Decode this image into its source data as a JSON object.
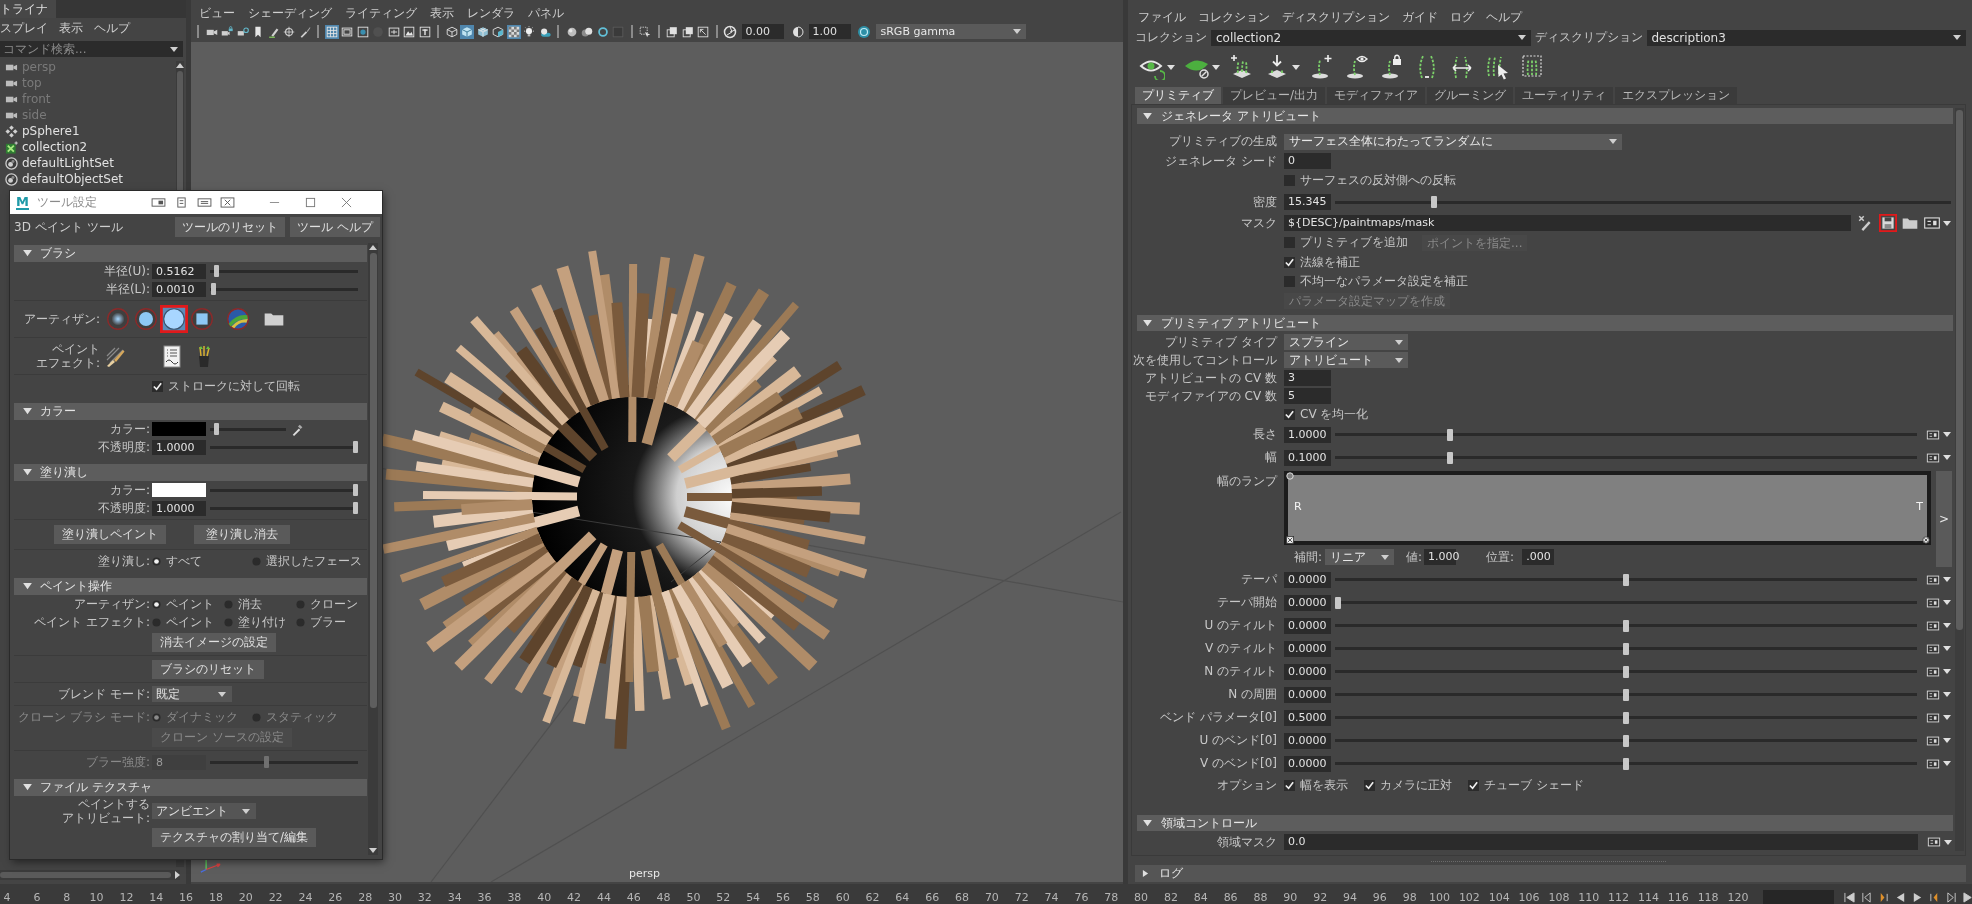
{
  "outliner": {
    "tab": "トライナ",
    "menu": [
      "スプレイ",
      "表示",
      "ヘルプ"
    ],
    "search": {
      "placeholder": "コマンド検索..."
    },
    "items": [
      {
        "label": "persp",
        "kind": "camera",
        "dimmed": true
      },
      {
        "label": "top",
        "kind": "camera",
        "dimmed": true
      },
      {
        "label": "front",
        "kind": "camera",
        "dimmed": true
      },
      {
        "label": "side",
        "kind": "camera",
        "dimmed": true
      },
      {
        "label": "pSphere1",
        "kind": "mesh",
        "dimmed": false
      },
      {
        "label": "collection2",
        "kind": "collection",
        "dimmed": false
      },
      {
        "label": "defaultLightSet",
        "kind": "set",
        "dimmed": false
      },
      {
        "label": "defaultObjectSet",
        "kind": "set",
        "dimmed": false
      }
    ]
  },
  "viewport": {
    "menu": [
      "ビュー",
      "シェーディング",
      "ライティング",
      "表示",
      "レンダラ",
      "パネル"
    ],
    "toolbar": [
      {
        "kind": "sep"
      },
      {
        "kind": "camera",
        "on": false
      },
      {
        "kind": "camlock",
        "on": false
      },
      {
        "kind": "camattr",
        "on": false
      },
      {
        "kind": "bookmark",
        "on": false
      },
      {
        "kind": "pen",
        "on": false
      },
      {
        "kind": "target",
        "on": false
      },
      {
        "kind": "brush",
        "on": false
      },
      {
        "kind": "sep"
      },
      {
        "kind": "grid",
        "on": true
      },
      {
        "kind": "film",
        "on": false
      },
      {
        "kind": "gate",
        "on": false
      },
      {
        "kind": "dot",
        "on": false
      },
      {
        "kind": "frame",
        "on": false
      },
      {
        "kind": "image",
        "on": false
      },
      {
        "kind": "text",
        "on": false
      },
      {
        "kind": "sep"
      },
      {
        "kind": "wire",
        "on": false
      },
      {
        "kind": "shaded",
        "on": true
      },
      {
        "kind": "textured",
        "on": false
      },
      {
        "kind": "lit",
        "on": false
      },
      {
        "kind": "xray",
        "on": true
      },
      {
        "kind": "bulb",
        "on": false
      },
      {
        "kind": "shadow",
        "on": false
      },
      {
        "kind": "sep"
      },
      {
        "kind": "ball",
        "on": false
      },
      {
        "kind": "balls",
        "on": false
      },
      {
        "kind": "ring",
        "on": false
      },
      {
        "kind": "square",
        "on": false
      },
      {
        "kind": "sep"
      },
      {
        "kind": "select",
        "on": false
      },
      {
        "kind": "sep"
      },
      {
        "kind": "copy",
        "on": false
      },
      {
        "kind": "copy",
        "on": false
      },
      {
        "kind": "resize",
        "on": false
      },
      {
        "kind": "sep"
      }
    ],
    "exposure": "0.00",
    "gamma": "1.00",
    "color_space": "sRGB gamma",
    "camera": "persp"
  },
  "tool_settings": {
    "logo": "M",
    "title": "ツール設定",
    "tool": "3D ペイント ツール",
    "buttons": [
      {
        "label": "ツールのリセット"
      },
      {
        "label": "ツール ヘルプ"
      }
    ],
    "sections": [
      {
        "title": "ブラシ",
        "expanded": true,
        "groups": [
          [
            {
              "kind": "slider",
              "label": "半径(U):",
              "value": "0.5162",
              "level": 0.03,
              "disabled": false
            },
            {
              "kind": "slider",
              "label": "半径(L):",
              "value": "0.0010",
              "level": 0.01,
              "disabled": false
            }
          ],
          [
            {
              "kind": "brushes",
              "label": "アーティザン:",
              "items": [
                {
                  "kind": "soft",
                  "selected": false,
                  "highlighted": false
                },
                {
                  "kind": "round",
                  "selected": false,
                  "highlighted": false
                },
                {
                  "kind": "large",
                  "selected": true,
                  "highlighted": true
                },
                {
                  "kind": "square",
                  "selected": false,
                  "highlighted": false
                },
                {
                  "kind": "globe",
                  "selected": false,
                  "highlighted": false
                },
                {
                  "kind": "folder",
                  "selected": false,
                  "highlighted": false
                }
              ]
            }
          ],
          [
            {
              "kind": "effects",
              "label_lines": [
                "ペイント",
                "エフェクト:"
              ],
              "items": [
                {
                  "kind": "stroke"
                },
                {
                  "kind": "document"
                },
                {
                  "kind": "bucket"
                }
              ]
            }
          ],
          [
            {
              "kind": "checkbox",
              "label": "ストロークに対して回転",
              "checked": true
            }
          ]
        ]
      },
      {
        "title": "カラー",
        "expanded": true,
        "groups": [
          [
            {
              "kind": "color",
              "label": "カラー:",
              "color": "#000000",
              "level": 0.05,
              "picker": true
            },
            {
              "kind": "slider",
              "label": "不透明度:",
              "value": "1.0000",
              "level": 1,
              "disabled": false
            }
          ]
        ]
      },
      {
        "title": "塗り潰し",
        "expanded": true,
        "groups": [
          [
            {
              "kind": "color",
              "label": "カラー:",
              "color": "#ffffff",
              "level": 1,
              "picker": false
            },
            {
              "kind": "slider",
              "label": "不透明度:",
              "value": "1.0000",
              "level": 1,
              "disabled": false
            }
          ],
          [
            {
              "kind": "buttons",
              "items": [
                {
                  "label": "塗り潰しペイント"
                },
                {
                  "label": "塗り潰し消去"
                }
              ]
            }
          ],
          [
            {
              "kind": "radios",
              "label": "塗り潰し:",
              "disabled": false,
              "options": [
                {
                  "label": "すべて",
                  "selected": true
                },
                {
                  "label": "選択したフェース",
                  "selected": false
                }
              ]
            }
          ]
        ]
      },
      {
        "title": "ペイント操作",
        "expanded": true,
        "groups": [
          [
            {
              "kind": "radios",
              "label": "アーティザン:",
              "disabled": false,
              "options": [
                {
                  "label": "ペイント",
                  "selected": true
                },
                {
                  "label": "消去",
                  "selected": false
                },
                {
                  "label": "クローン",
                  "selected": false
                }
              ]
            },
            {
              "kind": "radios",
              "label": "ペイント エフェクト:",
              "disabled": false,
              "options": [
                {
                  "label": "ペイント",
                  "selected": false
                },
                {
                  "label": "塗り付け",
                  "selected": false
                },
                {
                  "label": "ブラー",
                  "selected": false
                }
              ]
            },
            {
              "kind": "button",
              "label": "消去イメージの設定",
              "disabled": false
            }
          ],
          [
            {
              "kind": "button",
              "label": "ブラシのリセット",
              "disabled": false
            }
          ],
          [
            {
              "kind": "dropdown",
              "label": "ブレンド モード:",
              "value": "既定"
            }
          ],
          [
            {
              "kind": "radios",
              "label": "クローン ブラシ モード:",
              "disabled": true,
              "options": [
                {
                  "label": "ダイナミック",
                  "selected": true
                },
                {
                  "label": "スタティック",
                  "selected": false
                }
              ]
            },
            {
              "kind": "button",
              "label": "クローン ソースの設定",
              "disabled": true
            }
          ],
          [
            {
              "kind": "slider",
              "label": "ブラー強度:",
              "value": "8",
              "level": 0.38,
              "disabled": true
            }
          ]
        ]
      },
      {
        "title": "ファイル テクスチャ",
        "expanded": true,
        "groups": [
          [
            {
              "kind": "dropdown",
              "label_lines": [
                "ペイントする",
                "アトリビュート:"
              ],
              "value": "アンビエント"
            },
            {
              "kind": "button",
              "label": "テクスチャの割り当て/編集",
              "disabled": false
            }
          ]
        ]
      }
    ]
  },
  "xgen": {
    "menu": [
      "ファイル",
      "コレクション",
      "ディスクリプション",
      "ガイド",
      "ログ",
      "ヘルプ"
    ],
    "collection": {
      "label": "コレクション",
      "value": "collection2"
    },
    "description": {
      "label": "ディスクリプション",
      "value": "description3"
    },
    "toolbar": [
      {
        "kind": "eye",
        "menu": true
      },
      {
        "kind": "leaf",
        "menu": true
      },
      {
        "kind": "sprout",
        "menu": false
      },
      {
        "kind": "drop",
        "menu": true
      },
      {
        "kind": "add",
        "menu": false
      },
      {
        "kind": "reveal",
        "menu": false
      },
      {
        "kind": "lock",
        "menu": false
      },
      {
        "kind": "bend",
        "menu": false
      },
      {
        "kind": "swap",
        "menu": false
      },
      {
        "kind": "pick",
        "menu": false
      },
      {
        "kind": "frame",
        "menu": false
      }
    ],
    "tabs": [
      {
        "label": "プリミティブ",
        "selected": true
      },
      {
        "label": "プレビュー/出力",
        "selected": false
      },
      {
        "label": "モディファイア",
        "selected": false
      },
      {
        "label": "グルーミング",
        "selected": false
      },
      {
        "label": "ユーティリティ",
        "selected": false
      },
      {
        "label": "エクスプレッション",
        "selected": false
      }
    ],
    "sections": [
      {
        "title": "ジェネレータ アトリビュート",
        "expanded": true,
        "rows": [
          {
            "kind": "dropdown",
            "label": "プリミティブの生成",
            "value": "サーフェス全体にわたってランダムに"
          },
          {
            "kind": "number",
            "label": "ジェネレータ シード",
            "value": "0"
          },
          {
            "kind": "checkbox",
            "label": "サーフェスの反対側への反転",
            "checked": false
          },
          {
            "kind": "slider",
            "label": "密度",
            "value": "15.345",
            "level": 0.157,
            "map_button": false
          },
          {
            "kind": "path",
            "label": "マスク",
            "value": "${DESC}/paintmaps/mask",
            "buttons": [
              {
                "kind": "clear",
                "highlighted": false
              },
              {
                "kind": "save",
                "highlighted": true
              },
              {
                "kind": "folder",
                "highlighted": false
              },
              {
                "kind": "map",
                "highlighted": false
              }
            ]
          },
          {
            "kind": "checkbox",
            "label": "プリミティブを追加",
            "checked": false,
            "button": {
              "label": "ポイントを指定...",
              "disabled": true
            }
          },
          {
            "kind": "checkbox",
            "label": "法線を補正",
            "checked": true
          },
          {
            "kind": "checkbox",
            "label": "不均一なパラメータ設定を補正",
            "checked": false
          },
          {
            "kind": "button",
            "label": "パラメータ設定マップを作成",
            "disabled": true
          }
        ]
      },
      {
        "title": "プリミティブ アトリビュート",
        "expanded": true,
        "rows": [
          {
            "kind": "dropdown",
            "label": "プリミティブ タイプ",
            "value": "スプライン"
          },
          {
            "kind": "dropdown",
            "label": "次を使用してコントロール",
            "value": "アトリビュート"
          },
          {
            "kind": "number",
            "label": "アトリビュートの CV 数",
            "value": "3"
          },
          {
            "kind": "number",
            "label": "モディファイアの CV 数",
            "value": "5"
          },
          {
            "kind": "checkbox",
            "label": "CV を均一化",
            "checked": true
          },
          {
            "kind": "slider",
            "label": "長さ",
            "value": "1.0000",
            "level": 0.195,
            "map_button": true
          },
          {
            "kind": "slider",
            "label": "幅",
            "value": "0.1000",
            "level": 0.195,
            "map_button": true
          },
          {
            "kind": "ramp",
            "label": "幅のランプ",
            "start": "R",
            "end": "T",
            "expand": ">",
            "interpolation_label": "補間:",
            "interpolation": "リニア",
            "value_label": "値:",
            "value": "1.000",
            "position_label": "位置:",
            "position": ".000"
          },
          {
            "kind": "slider",
            "label": "テーパ",
            "value": "0.0000",
            "level": 0.5,
            "map_button": true
          },
          {
            "kind": "slider",
            "label": "テーパ開始",
            "value": "0.0000",
            "level": 0,
            "map_button": true
          },
          {
            "kind": "slider",
            "label": "U のティルト",
            "value": "0.0000",
            "level": 0.5,
            "map_button": true
          },
          {
            "kind": "slider",
            "label": "V のティルト",
            "value": "0.0000",
            "level": 0.5,
            "map_button": true
          },
          {
            "kind": "slider",
            "label": "N のティルト",
            "value": "0.0000",
            "level": 0.5,
            "map_button": true
          },
          {
            "kind": "slider",
            "label": "N の周囲",
            "value": "0.0000",
            "level": 0.5,
            "map_button": true
          },
          {
            "kind": "slider",
            "label": "ベンド パラメータ[0]",
            "value": "0.5000",
            "level": 0.5,
            "map_button": true
          },
          {
            "kind": "slider",
            "label": "U のベンド[0]",
            "value": "0.0000",
            "level": 0.5,
            "map_button": true
          },
          {
            "kind": "slider",
            "label": "V のベンド[0]",
            "value": "0.0000",
            "level": 0.5,
            "map_button": true
          },
          {
            "kind": "options",
            "label": "オプション",
            "items": [
              {
                "label": "幅を表示",
                "checked": true
              },
              {
                "label": "カメラに正対",
                "checked": true
              },
              {
                "label": "チューブ シェード",
                "checked": true
              }
            ]
          }
        ]
      },
      {
        "title": "領域コントロール",
        "expanded": true,
        "rows": [
          {
            "kind": "text",
            "label": "領域マスク",
            "value": "0.0",
            "map_button": true
          }
        ]
      }
    ],
    "log": {
      "title": "ログ",
      "expanded": false
    }
  },
  "timeline": {
    "frames": [
      "4",
      "6",
      "8",
      "10",
      "12",
      "14",
      "16",
      "18",
      "20",
      "22",
      "24",
      "26",
      "28",
      "30",
      "32",
      "34",
      "36",
      "38",
      "40",
      "42",
      "44",
      "46",
      "48",
      "50",
      "52",
      "54",
      "56",
      "58",
      "60",
      "62",
      "64",
      "66",
      "68",
      "70",
      "72",
      "74",
      "76",
      "78",
      "80",
      "82",
      "84",
      "86",
      "88",
      "90",
      "92",
      "94",
      "96",
      "98",
      "100",
      "102",
      "104",
      "106",
      "108",
      "110",
      "112",
      "114",
      "116",
      "118",
      "120"
    ]
  }
}
